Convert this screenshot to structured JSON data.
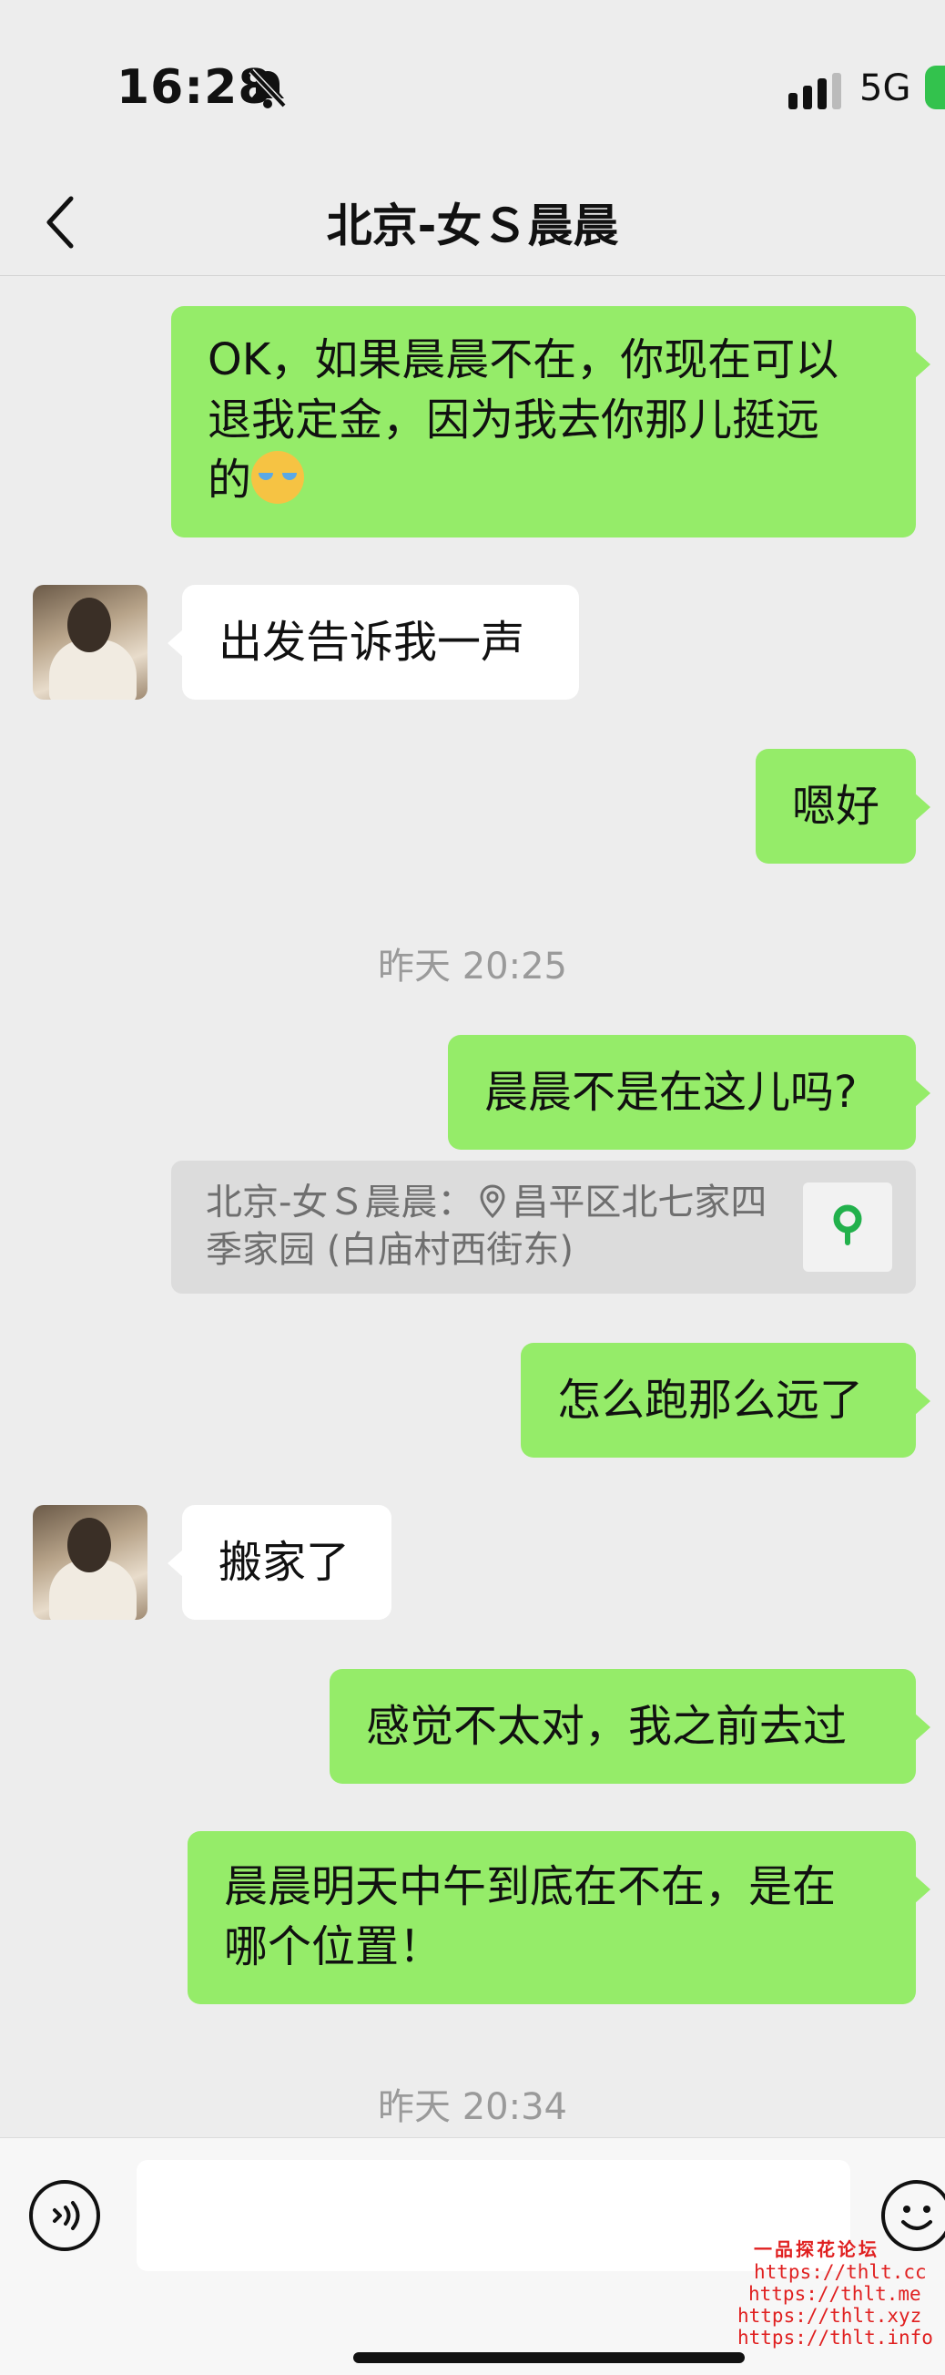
{
  "status_bar": {
    "time": "16:28",
    "network": "5G",
    "icons": [
      "bell-muted-icon",
      "signal-icon",
      "battery-icon"
    ]
  },
  "nav": {
    "title": "北京-女Ｓ晨晨",
    "back_icon": "chevron-left-icon"
  },
  "messages": [
    {
      "side": "out",
      "lines": [
        "OK，如果晨晨不在，你现在可以",
        "退我定金，因为我去你那儿挺远",
        "的"
      ],
      "emoji": "crying-laughing-emoji"
    },
    {
      "side": "in",
      "text": "出发告诉我一声"
    },
    {
      "side": "out",
      "text": "嗯好"
    },
    {
      "type": "timestamp",
      "text": "昨天 20:25"
    },
    {
      "side": "out",
      "text": "晨晨不是在这儿吗?"
    },
    {
      "type": "location-quote",
      "prefix": "北京-女Ｓ晨晨：",
      "line1": "昌平区北七家四",
      "line2": "季家园 (白庙村西街东)"
    },
    {
      "side": "out",
      "text": "怎么跑那么远了"
    },
    {
      "side": "in",
      "text": "搬家了"
    },
    {
      "side": "out",
      "text": "感觉不太对，我之前去过"
    },
    {
      "side": "out",
      "lines": [
        "晨晨明天中午到底在不在，是在",
        "哪个位置！"
      ]
    },
    {
      "type": "timestamp",
      "text": "昨天 20:34"
    }
  ],
  "input_bar": {
    "voice_icon": "voice-icon",
    "emoji_icon": "smile-icon"
  },
  "watermark": {
    "title": "一品探花论坛",
    "urls": [
      "https://thlt.cc",
      "https://thlt.me",
      "https://thlt.xyz",
      "https://thlt.info"
    ]
  },
  "colors": {
    "outgoing": "#95ec69",
    "incoming": "#ffffff",
    "background": "#ededed",
    "pin": "#22b14c"
  }
}
